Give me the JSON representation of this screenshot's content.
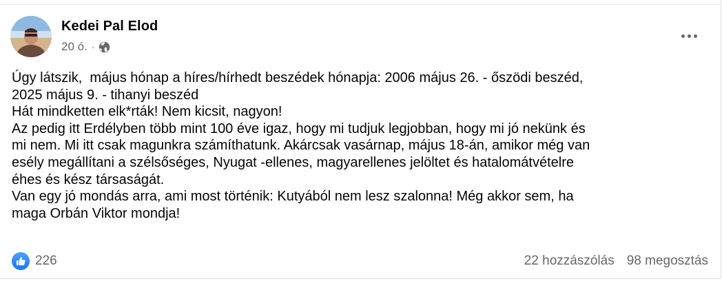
{
  "post": {
    "author": "Kedei Pal Elod",
    "time": "20 ó.",
    "separator": "·",
    "privacy_icon": "globe-icon",
    "paragraphs": [
      "Úgy látszik,  május hónap a híres/hírhedt beszédek hónapja: 2006 május 26. - őszödi beszéd,\n2025 május 9. - tihanyi beszéd",
      "Hát mindketten elk*rták! Nem kicsit, nagyon!",
      "Az pedig itt Erdélyben több mint 100 éve igaz, hogy mi tudjuk legjobban, hogy mi jó nekünk és\nmi nem. Mi itt csak magunkra számíthatunk. Akárcsak vasárnap, május 18-án, amikor még van\nesély megállítani a szélsőséges, Nyugat -ellenes, magyarellenes jelöltet és hatalomátvételre\néhes és kész társaságát.",
      "Van egy jó mondás arra, ami most történik: Kutyából nem lesz szalonna! Még akkor sem, ha\nmaga Orbán Viktor mondja!"
    ]
  },
  "footer": {
    "reaction_icon": "like-icon",
    "reaction_count": "226",
    "comments": "22 hozzászólás",
    "shares": "98 megosztás"
  },
  "colors": {
    "text": "#050505",
    "secondary": "#65676b",
    "like_blue": "#1877f2"
  }
}
